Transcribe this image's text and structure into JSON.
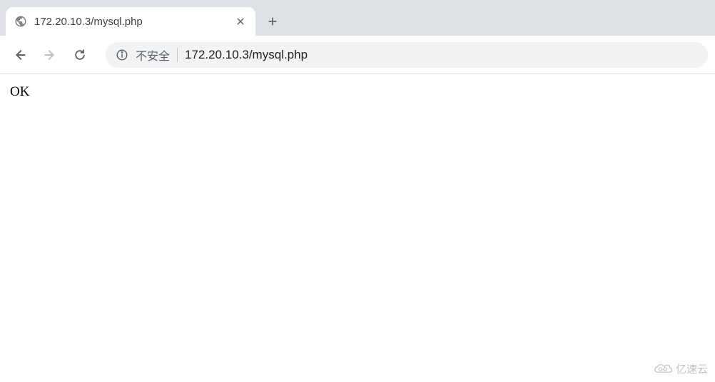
{
  "tab": {
    "title": "172.20.10.3/mysql.php"
  },
  "toolbar": {
    "security_label": "不安全",
    "url": "172.20.10.3/mysql.php"
  },
  "page": {
    "body_text": "OK"
  },
  "watermark": {
    "text": "亿速云"
  }
}
